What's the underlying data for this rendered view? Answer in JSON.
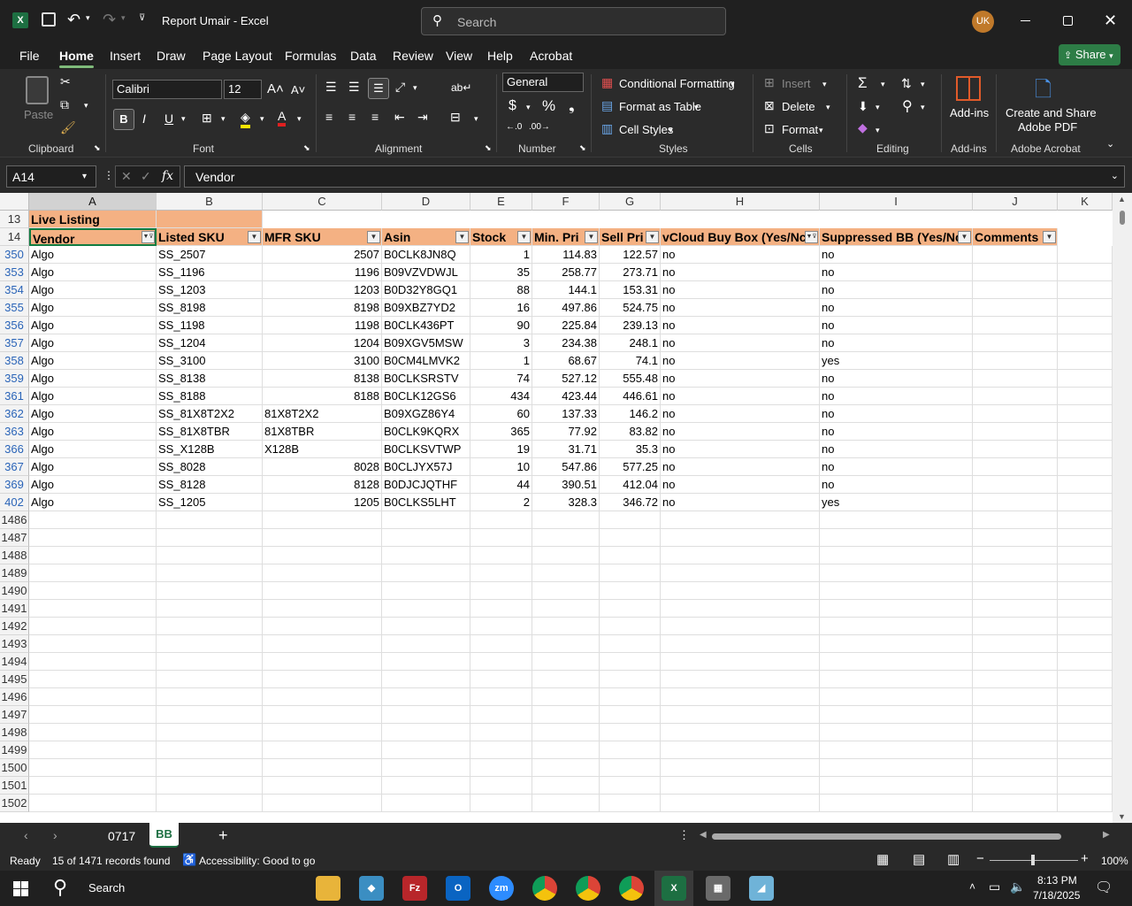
{
  "app": {
    "doc_title": "Report Umair",
    "separator": "-",
    "app_name": "Excel",
    "search_placeholder": "Search",
    "user_initials": "UK"
  },
  "menu": [
    "File",
    "Home",
    "Insert",
    "Draw",
    "Page Layout",
    "Formulas",
    "Data",
    "Review",
    "View",
    "Help",
    "Acrobat"
  ],
  "share_label": "Share",
  "ribbon": {
    "clipboard": {
      "paste": "Paste",
      "label": "Clipboard"
    },
    "font": {
      "name": "Calibri",
      "size": "12",
      "label": "Font"
    },
    "alignment": {
      "label": "Alignment"
    },
    "number": {
      "format": "General",
      "label": "Number"
    },
    "styles": {
      "conditional": "Conditional Formatting",
      "format_table": "Format as Table",
      "cell_styles": "Cell Styles",
      "label": "Styles"
    },
    "cells": {
      "insert": "Insert",
      "delete": "Delete",
      "format": "Format",
      "label": "Cells"
    },
    "editing": {
      "label": "Editing"
    },
    "addins": {
      "btn": "Add-ins",
      "label": "Add-ins"
    },
    "acrobat": {
      "btn1": "Create and Share",
      "btn2": "Adobe PDF",
      "label": "Adobe Acrobat"
    }
  },
  "formula_bar": {
    "name_box": "A14",
    "fx": "fx",
    "value": "Vendor"
  },
  "columns": [
    "A",
    "B",
    "C",
    "D",
    "E",
    "F",
    "G",
    "H",
    "I",
    "J",
    "K"
  ],
  "title_row": {
    "row": "13",
    "text": "Live Listing"
  },
  "header_row": {
    "row": "14",
    "cells": [
      "Vendor",
      "Listed SKU",
      "MFR SKU",
      "Asin",
      "Stock",
      "Min. Pri",
      "Sell Pri",
      "vCloud Buy Box (Yes/Nc",
      "Suppressed BB (Yes/Nc",
      "Comments"
    ]
  },
  "rows": [
    {
      "row": "350",
      "cells": [
        "Algo",
        "SS_2507",
        "2507",
        "B0CLK8JN8Q",
        "1",
        "114.83",
        "122.57",
        "no",
        "no",
        ""
      ]
    },
    {
      "row": "353",
      "cells": [
        "Algo",
        "SS_1196",
        "1196",
        "B09VZVDWJL",
        "35",
        "258.77",
        "273.71",
        "no",
        "no",
        ""
      ]
    },
    {
      "row": "354",
      "cells": [
        "Algo",
        "SS_1203",
        "1203",
        "B0D32Y8GQ1",
        "88",
        "144.1",
        "153.31",
        "no",
        "no",
        ""
      ]
    },
    {
      "row": "355",
      "cells": [
        "Algo",
        "SS_8198",
        "8198",
        "B09XBZ7YD2",
        "16",
        "497.86",
        "524.75",
        "no",
        "no",
        ""
      ]
    },
    {
      "row": "356",
      "cells": [
        "Algo",
        "SS_1198",
        "1198",
        "B0CLK436PT",
        "90",
        "225.84",
        "239.13",
        "no",
        "no",
        ""
      ]
    },
    {
      "row": "357",
      "cells": [
        "Algo",
        "SS_1204",
        "1204",
        "B09XGV5MSW",
        "3",
        "234.38",
        "248.1",
        "no",
        "no",
        ""
      ]
    },
    {
      "row": "358",
      "cells": [
        "Algo",
        "SS_3100",
        "3100",
        "B0CM4LMVK2",
        "1",
        "68.67",
        "74.1",
        "no",
        "yes",
        ""
      ]
    },
    {
      "row": "359",
      "cells": [
        "Algo",
        "SS_8138",
        "8138",
        "B0CLKSRSTV",
        "74",
        "527.12",
        "555.48",
        "no",
        "no",
        ""
      ]
    },
    {
      "row": "361",
      "cells": [
        "Algo",
        "SS_8188",
        "8188",
        "B0CLK12GS6",
        "434",
        "423.44",
        "446.61",
        "no",
        "no",
        ""
      ]
    },
    {
      "row": "362",
      "cells": [
        "Algo",
        "SS_81X8T2X2",
        "81X8T2X2",
        "B09XGZ86Y4",
        "60",
        "137.33",
        "146.2",
        "no",
        "no",
        ""
      ]
    },
    {
      "row": "363",
      "cells": [
        "Algo",
        "SS_81X8TBR",
        "81X8TBR",
        "B0CLK9KQRX",
        "365",
        "77.92",
        "83.82",
        "no",
        "no",
        ""
      ]
    },
    {
      "row": "366",
      "cells": [
        "Algo",
        "SS_X128B",
        "X128B",
        "B0CLKSVTWP",
        "19",
        "31.71",
        "35.3",
        "no",
        "no",
        ""
      ]
    },
    {
      "row": "367",
      "cells": [
        "Algo",
        "SS_8028",
        "8028",
        "B0CLJYX57J",
        "10",
        "547.86",
        "577.25",
        "no",
        "no",
        ""
      ]
    },
    {
      "row": "369",
      "cells": [
        "Algo",
        "SS_8128",
        "8128",
        "B0DJCJQTHF",
        "44",
        "390.51",
        "412.04",
        "no",
        "no",
        ""
      ]
    },
    {
      "row": "402",
      "cells": [
        "Algo",
        "SS_1205",
        "1205",
        "B0CLKS5LHT",
        "2",
        "328.3",
        "346.72",
        "no",
        "yes",
        ""
      ]
    }
  ],
  "empty_rows": [
    "1486",
    "1487",
    "1488",
    "1489",
    "1490",
    "1491",
    "1492",
    "1493",
    "1494",
    "1495",
    "1496",
    "1497",
    "1498",
    "1499",
    "1500",
    "1501",
    "1502"
  ],
  "sheets": [
    "0717",
    "BB"
  ],
  "status": {
    "ready": "Ready",
    "records": "15 of 1471 records found",
    "accessibility": "Accessibility: Good to go",
    "zoom": "100%"
  },
  "taskbar": {
    "search": "Search",
    "time": "8:13 PM",
    "date": "7/18/2025"
  },
  "colors": {
    "header_fill": "#f4b183",
    "accent": "#7fba7a",
    "share": "#2d7d46"
  }
}
